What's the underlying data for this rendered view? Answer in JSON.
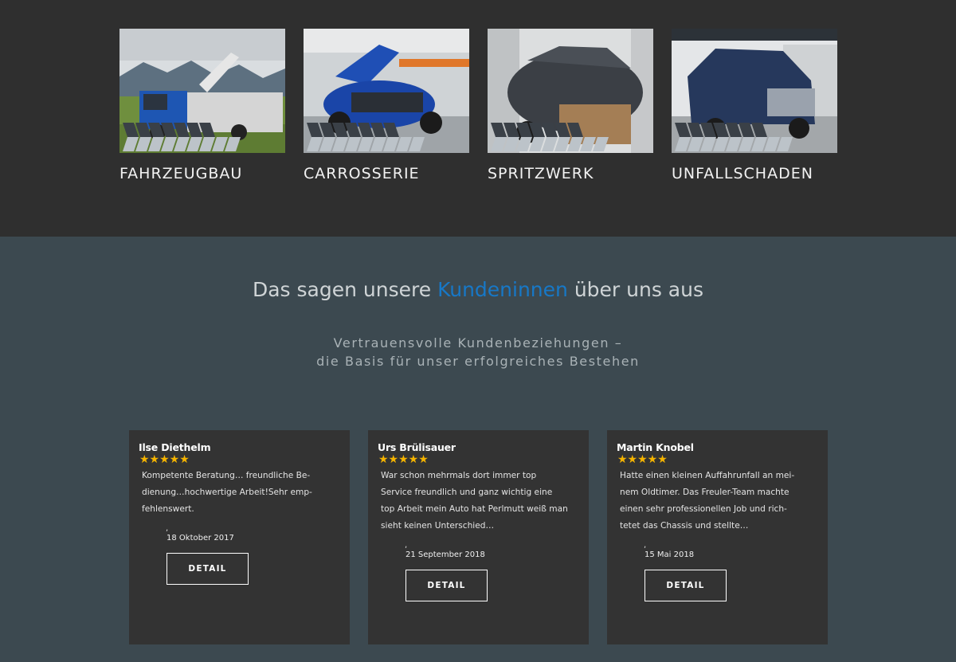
{
  "services": [
    {
      "label": "FAHRZEUGBAU"
    },
    {
      "label": "CARROSSERIE"
    },
    {
      "label": "SPRITZWERK"
    },
    {
      "label": "UNFALLSCHADEN"
    }
  ],
  "testimonials": {
    "heading_pre": "Das sagen unsere ",
    "heading_highlight": "Kundeninnen",
    "heading_post": " über uns aus",
    "subheading_line1": "Vertrauensvolle Kundenbeziehungen –",
    "subheading_line2": "die Basis für unser erfolgreiches Bestehen",
    "stars": "★★★★★",
    "comma": ",",
    "cards": [
      {
        "name": "Ilse Diethelm",
        "text": "Kompetente Beratung… freundliche Be-dienung…hochwertige Arbeit!Sehr emp-fehlenswert.",
        "date": "18 Oktober 2017",
        "button": "DETAIL"
      },
      {
        "name": "Urs Brülisauer",
        "text": "War schon mehrmals dort immer top Service freundlich und ganz wichtig eine top Arbeit mein Auto hat Perlmutt weiß man sieht keinen Unterschied…",
        "date": "21 September 2018",
        "button": "DETAIL"
      },
      {
        "name": "Martin Knobel",
        "text": "Hatte einen kleinen Auffahrunfall an mei-nem Oldtimer. Das Freuler-Team machte einen sehr professionellen Job und rich-tetet das Chassis und stellte…",
        "date": "15 Mai 2018",
        "button": "DETAIL"
      }
    ]
  }
}
